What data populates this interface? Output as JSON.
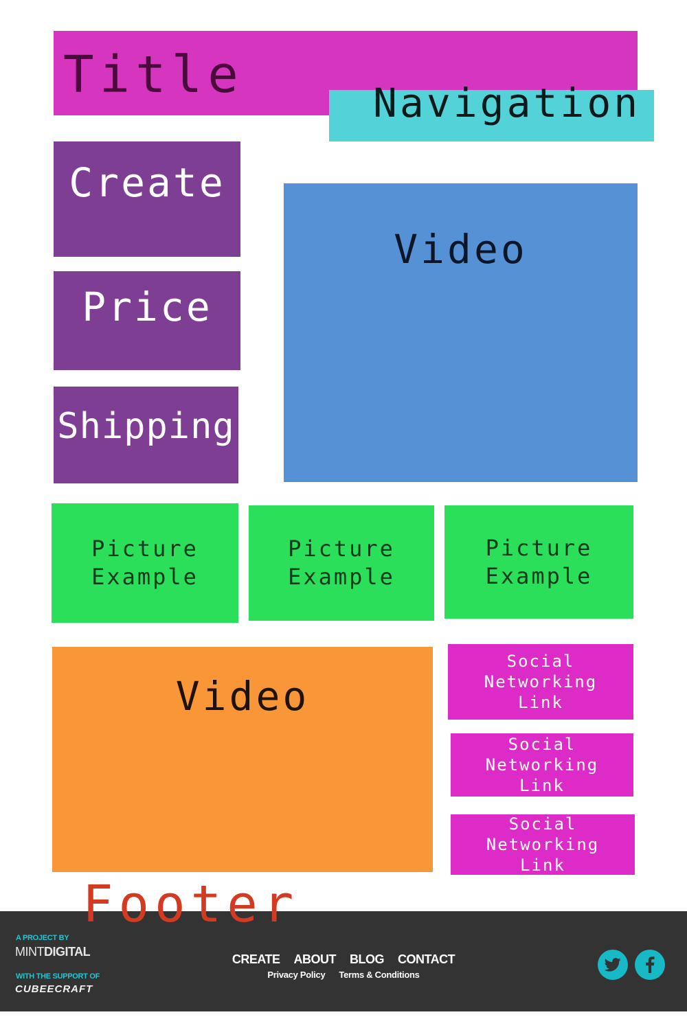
{
  "header": {
    "title": "Title",
    "navigation": "Navigation"
  },
  "sidebar": {
    "create": "Create",
    "price": "Price",
    "shipping": "Shipping"
  },
  "main": {
    "video_top": "Video",
    "pictures": [
      {
        "line1": "Picture",
        "line2": "Example"
      },
      {
        "line1": "Picture",
        "line2": "Example"
      },
      {
        "line1": "Picture",
        "line2": "Example"
      }
    ],
    "video_bottom": "Video",
    "social_links": [
      {
        "line1": "Social Networking",
        "line2": "Link"
      },
      {
        "line1": "Social Networking",
        "line2": "Link"
      },
      {
        "line1": "Social Networking",
        "line2": "Link"
      }
    ],
    "footer_label": "Footer"
  },
  "footer": {
    "project_by": "A PROJECT BY",
    "mint_logo_left": "MINT",
    "mint_logo_right": "DIGITAL",
    "support_of": "WITH THE SUPPORT OF",
    "partner_logo": "CUBEECRAFT",
    "nav": [
      "CREATE",
      "ABOUT",
      "BLOG",
      "CONTACT"
    ],
    "legal": [
      "Privacy Policy",
      "Terms & Conditions"
    ],
    "icons": [
      "twitter-icon",
      "facebook-icon"
    ],
    "icon_color": "#18b9c6"
  }
}
